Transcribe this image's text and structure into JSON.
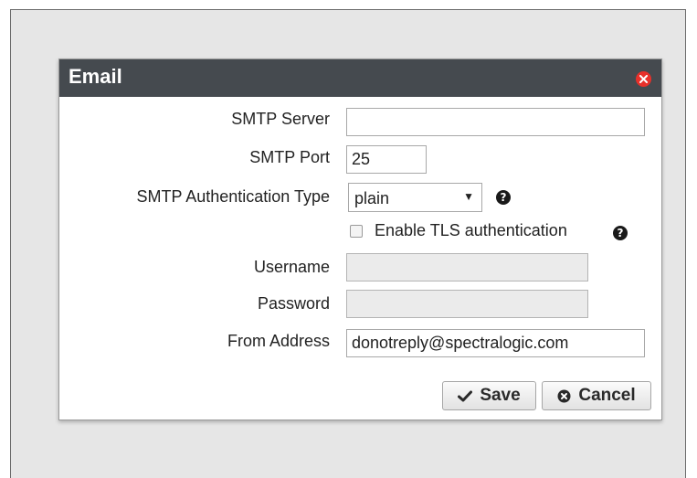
{
  "dialog": {
    "title": "Email",
    "close_icon": "close-icon"
  },
  "form": {
    "smtp_server": {
      "label": "SMTP Server",
      "value": ""
    },
    "smtp_port": {
      "label": "SMTP Port",
      "value": "25"
    },
    "auth_type": {
      "label": "SMTP Authentication Type",
      "selected": "plain",
      "help_icon": "question-circle-icon"
    },
    "enable_tls": {
      "label": "Enable TLS authentication",
      "checked": false,
      "help_icon": "question-circle-icon"
    },
    "username": {
      "label": "Username",
      "value": "",
      "disabled": true
    },
    "password": {
      "label": "Password",
      "value": "",
      "disabled": true
    },
    "from_address": {
      "label": "From Address",
      "value": "donotreply@spectralogic.com"
    }
  },
  "actions": {
    "save_label": "Save",
    "save_icon": "checkmark-icon",
    "cancel_label": "Cancel",
    "cancel_icon": "x-circle-icon"
  },
  "colors": {
    "titlebar": "#454a4f",
    "close": "#e8302a",
    "backdrop": "#e6e6e6"
  }
}
